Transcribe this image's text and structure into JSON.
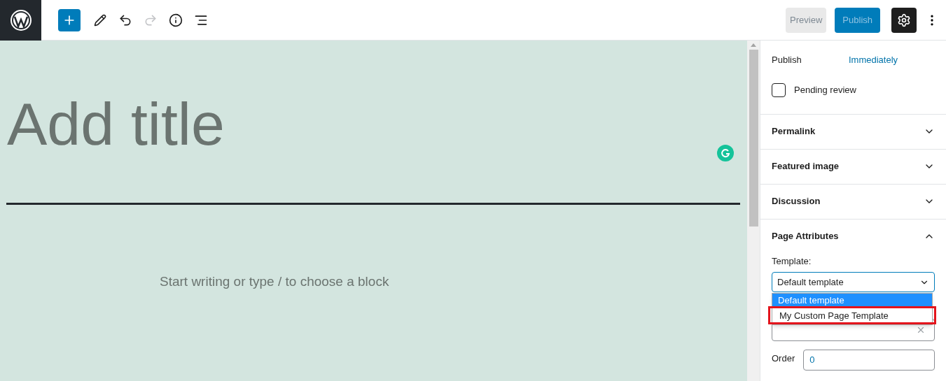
{
  "toolbar": {
    "buttons": [
      {
        "kind": "add"
      },
      {
        "kind": "edit"
      },
      {
        "kind": "undo",
        "disabled": false
      },
      {
        "kind": "redo",
        "disabled": true
      },
      {
        "kind": "info"
      },
      {
        "kind": "outline"
      }
    ],
    "preview": "Preview",
    "publish": "Publish",
    "settings_selected": true
  },
  "editor": {
    "title_placeholder": "Add title",
    "body_placeholder": "Start writing or type / to choose a block"
  },
  "sidebar": {
    "publish_label": "Publish",
    "publish_value": "Immediately",
    "pending_review": {
      "label": "Pending review",
      "checked": false
    },
    "panels": [
      {
        "title": "Permalink",
        "expanded": false
      },
      {
        "title": "Featured image",
        "expanded": false
      },
      {
        "title": "Discussion",
        "expanded": false
      },
      {
        "title": "Page Attributes",
        "expanded": true
      }
    ],
    "template": {
      "label": "Template:",
      "value": "Default template",
      "options": [
        {
          "label": "Default template",
          "selected": true,
          "annotated": false
        },
        {
          "label": "My Custom Page Template",
          "selected": false,
          "annotated": true
        }
      ]
    },
    "order": {
      "label": "Order",
      "value": "0"
    }
  }
}
